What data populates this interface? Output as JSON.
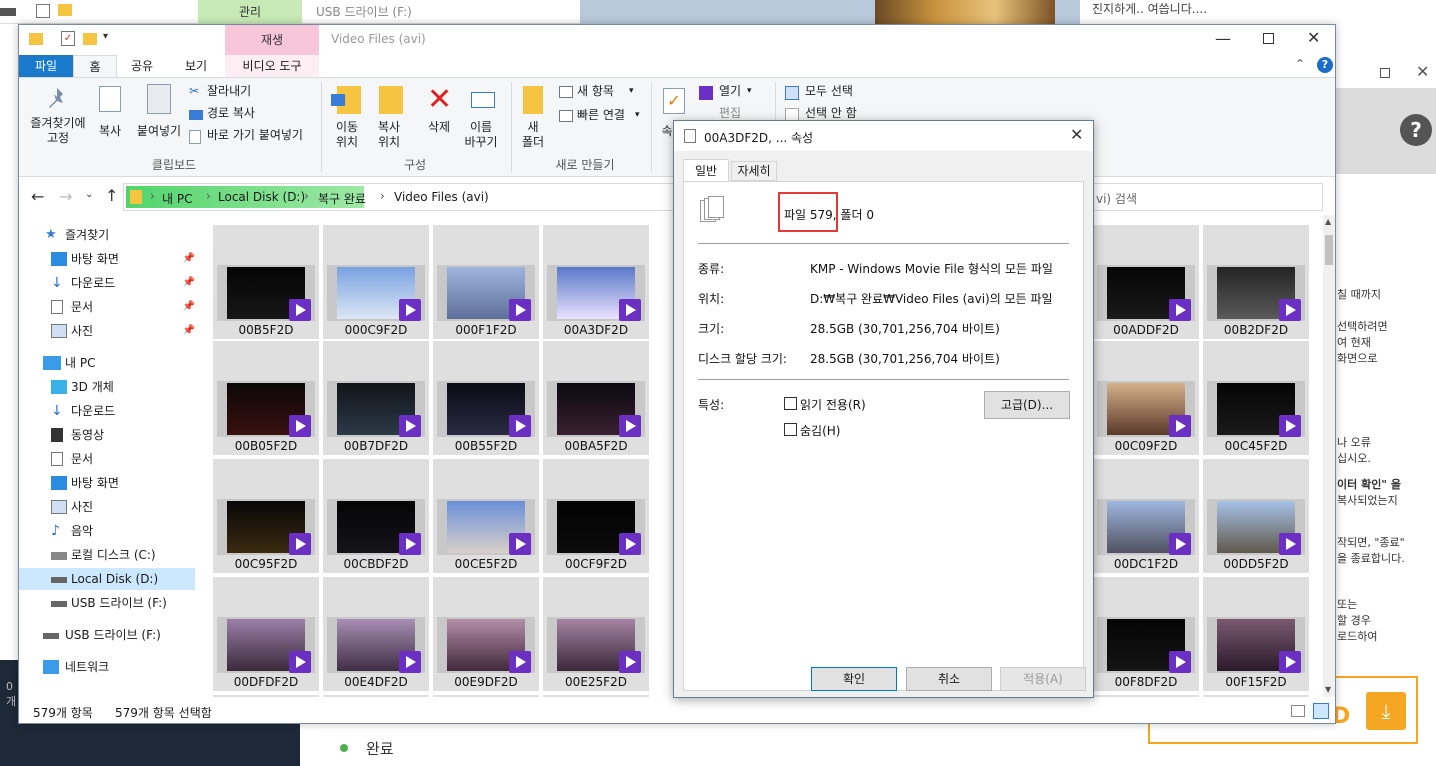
{
  "background": {
    "explorer_tab_manage": "관리",
    "explorer_tab_usb": "USB 드라이브 (F:)",
    "web_text_top": "진지하게.. 여씁니다....",
    "bottom_list_item": "완료",
    "left_fragment": "0개",
    "right_sidebar_lines": [
      "칠 때까지",
      "선택하려면",
      "여 현재",
      "화면으로",
      "나 오류",
      "십시오.",
      "이터 확인\" 을",
      "복사되었는지",
      "작되면, \"종료\"",
      "을 종료합니다.",
      "또는",
      "할 경우",
      "로드하여"
    ],
    "download_label": "DOWNLOAD"
  },
  "explorer": {
    "context_tab": "재생",
    "path_title": "Video Files (avi)",
    "tabs": [
      "파일",
      "홈",
      "공유",
      "보기",
      "비디오 도구"
    ],
    "ribbon": {
      "pin_label": "즐겨찾기에\n고정",
      "copy_label": "복사",
      "paste_label": "붙여넣기",
      "cut_label": "잘라내기",
      "copy_path_label": "경로 복사",
      "paste_shortcut_label": "바로 가기 붙여넣기",
      "clipboard_group": "클립보드",
      "move_to_label": "이동\n위치",
      "copy_to_label": "복사\n위치",
      "delete_label": "삭제",
      "rename_label": "이름\n바꾸기",
      "organize_group": "구성",
      "new_folder_label": "새\n폴더",
      "new_item_label": "새 항목",
      "easy_access_label": "빠른 연결",
      "new_group": "새로 만들기",
      "properties_label": "속",
      "open_label": "열기",
      "edit_label": "편집",
      "select_all_label": "모두 선택",
      "select_none_label": "선택 안 함"
    },
    "breadcrumb": [
      "내 PC",
      "Local Disk (D:)",
      "복구 완료",
      "Video Files (avi)"
    ],
    "search_placeholder": "vi) 검색",
    "nav": {
      "quick_access": "즐겨찾기",
      "quick_items": [
        "바탕 화면",
        "다운로드",
        "문서",
        "사진"
      ],
      "this_pc": "내 PC",
      "pc_items": [
        "3D 개체",
        "다운로드",
        "동영상",
        "문서",
        "바탕 화면",
        "사진",
        "음악",
        "로컬 디스크 (C:)",
        "Local Disk (D:)",
        "USB 드라이브 (F:)"
      ],
      "usb_root": "USB 드라이브 (F:)",
      "network": "네트워크"
    },
    "thumbnails": [
      [
        "00B5F2D",
        "000C9F2D",
        "000F1F2D",
        "00A3DF2D",
        "",
        "",
        "",
        "",
        "00ADDF2D",
        "00B2DF2D"
      ],
      [
        "00B05F2D",
        "00B7DF2D",
        "00B55F2D",
        "00BA5F2D",
        "",
        "",
        "",
        "",
        "00C09F2D",
        "00C45F2D"
      ],
      [
        "00C95F2D",
        "00CBDF2D",
        "00CE5F2D",
        "00CF9F2D",
        "",
        "",
        "",
        "",
        "00DC1F2D",
        "00DD5F2D"
      ],
      [
        "00DFDF2D",
        "00E4DF2D",
        "00E9DF2D",
        "00E25F2D",
        "",
        "",
        "",
        "",
        "00F8DF2D",
        "00F15F2D"
      ]
    ],
    "status_count": "579개 항목",
    "status_selected": "579개 항목 선택함"
  },
  "dialog": {
    "title": "00A3DF2D, ... 속성",
    "tabs": [
      "일반",
      "자세히"
    ],
    "summary": "파일 579, 폴더 0",
    "rows": [
      {
        "label": "종류:",
        "value": "KMP - Windows Movie File 형식의 모든 파일"
      },
      {
        "label": "위치:",
        "value": "D:₩복구 완료₩Video Files (avi)의 모든 파일"
      },
      {
        "label": "크기:",
        "value": "28.5GB (30,701,256,704 바이트)"
      },
      {
        "label": "디스크 할당 크기:",
        "value": "28.5GB (30,701,256,704 바이트)"
      }
    ],
    "attributes_label": "특성:",
    "readonly_label": "읽기 전용(R)",
    "hidden_label": "숨김(H)",
    "advanced_button": "고급(D)...",
    "ok_button": "확인",
    "cancel_button": "취소",
    "apply_button": "적용(A)"
  },
  "colors": {
    "file_tab": "#1979ca",
    "context_tab": "#f7c6d9",
    "manage_tab": "#c7eab7",
    "kmp_badge": "#6c2fc3",
    "highlight_box": "#e53935",
    "download_orange": "#f5a623"
  }
}
